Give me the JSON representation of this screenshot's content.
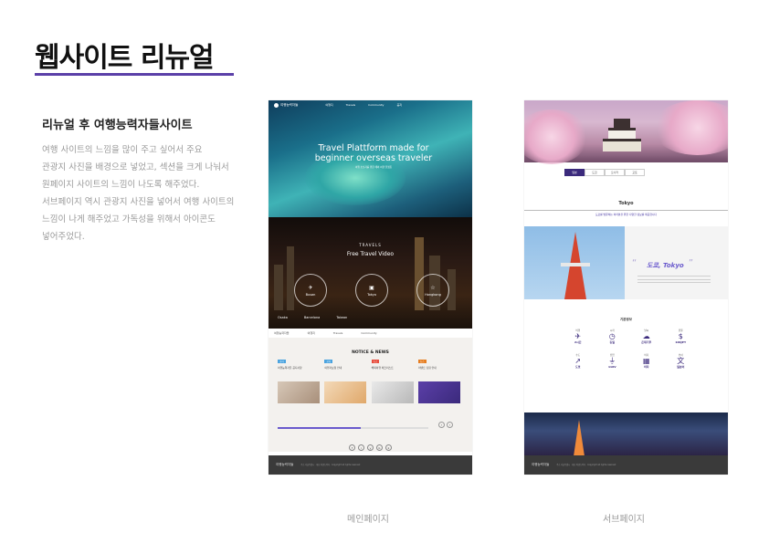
{
  "header": {
    "title": "웹사이트 리뉴얼"
  },
  "intro": {
    "subtitle": "리뉴얼 후 여행능력자들사이트",
    "lines": [
      "여행 사이트의 느낌을 많이 주고 싶어서 주요",
      "관광지 사진을 배경으로 넣었고, 섹션을 크게 나눠서",
      "원페이지 사이트의 느낌이 나도록 해주었다.",
      "서브페이지 역시 관광지 사진을 넣어서 여행 사이트의",
      "느낌이 나게 해주었고 가독성을 위해서 아이콘도",
      "넣어주었다."
    ]
  },
  "main_page": {
    "caption": "메인페이지",
    "logo": "여행능력자들",
    "nav": [
      "여행지",
      "Travels",
      "Community",
      "공지"
    ],
    "hero_title": "Travel Plattform made for beginner overseas traveler",
    "hero_sub": "여행 초보자를 위한 해외 여행 플랫폼",
    "travels_label": "TRAVELS",
    "video_title": "Free Travel Video",
    "hexes": [
      {
        "glyph": "✈",
        "label": "Busan"
      },
      {
        "glyph": "▣",
        "label": "Tokyo"
      },
      {
        "glyph": "☆",
        "label": "Hongkong"
      }
    ],
    "cities": [
      "Osaka",
      "Barcelona",
      "Taiwan"
    ],
    "notice_title": "NOTICE & NEWS",
    "notices": [
      {
        "tag": "공지",
        "text": "여행능력자들 공지사항",
        "color": "#4aa3df"
      },
      {
        "tag": "공지",
        "text": "여행자보험 안내",
        "color": "#4aa3df"
      },
      {
        "tag": "뉴스",
        "text": "해외여행 체크리스트",
        "color": "#e74c3c"
      },
      {
        "tag": "뉴스",
        "text": "이벤트 당첨 안내",
        "color": "#e67e22"
      }
    ],
    "sns": [
      "f",
      "i",
      "y",
      "b",
      "k"
    ],
    "footer_logo": "여행능력자들",
    "footer_text": "주소 서울특별시 · 대표 여행능력자 · Copyright all rights reserved"
  },
  "sub_page": {
    "caption": "서브페이지",
    "tabs": [
      "일본",
      "도쿄",
      "오사카",
      "교토"
    ],
    "heading": "Tokyo",
    "desc": "도쿄를 방문하는 여러분을 위한 다양한 정보를 제공합니다",
    "city_name": "도쿄, Tokyo",
    "info_title": "기본정보",
    "icons": [
      {
        "glyph": "✈",
        "value": "2시간",
        "label": "비행"
      },
      {
        "glyph": "◷",
        "value": "동일",
        "label": "시차"
      },
      {
        "glyph": "☁",
        "value": "온대기후",
        "label": "날씨"
      },
      {
        "glyph": "$",
        "value": "100JPY",
        "label": "환율"
      },
      {
        "glyph": "↗",
        "value": "도쿄",
        "label": "수도"
      },
      {
        "glyph": "⏚",
        "value": "110V",
        "label": "전압"
      },
      {
        "glyph": "▦",
        "value": "비자",
        "label": "비자"
      },
      {
        "glyph": "文",
        "value": "일본어",
        "label": "언어"
      }
    ],
    "footer_logo": "여행능력자들",
    "footer_text": "주소 서울특별시 · 대표 여행능력자 · Copyright all rights reserved"
  }
}
